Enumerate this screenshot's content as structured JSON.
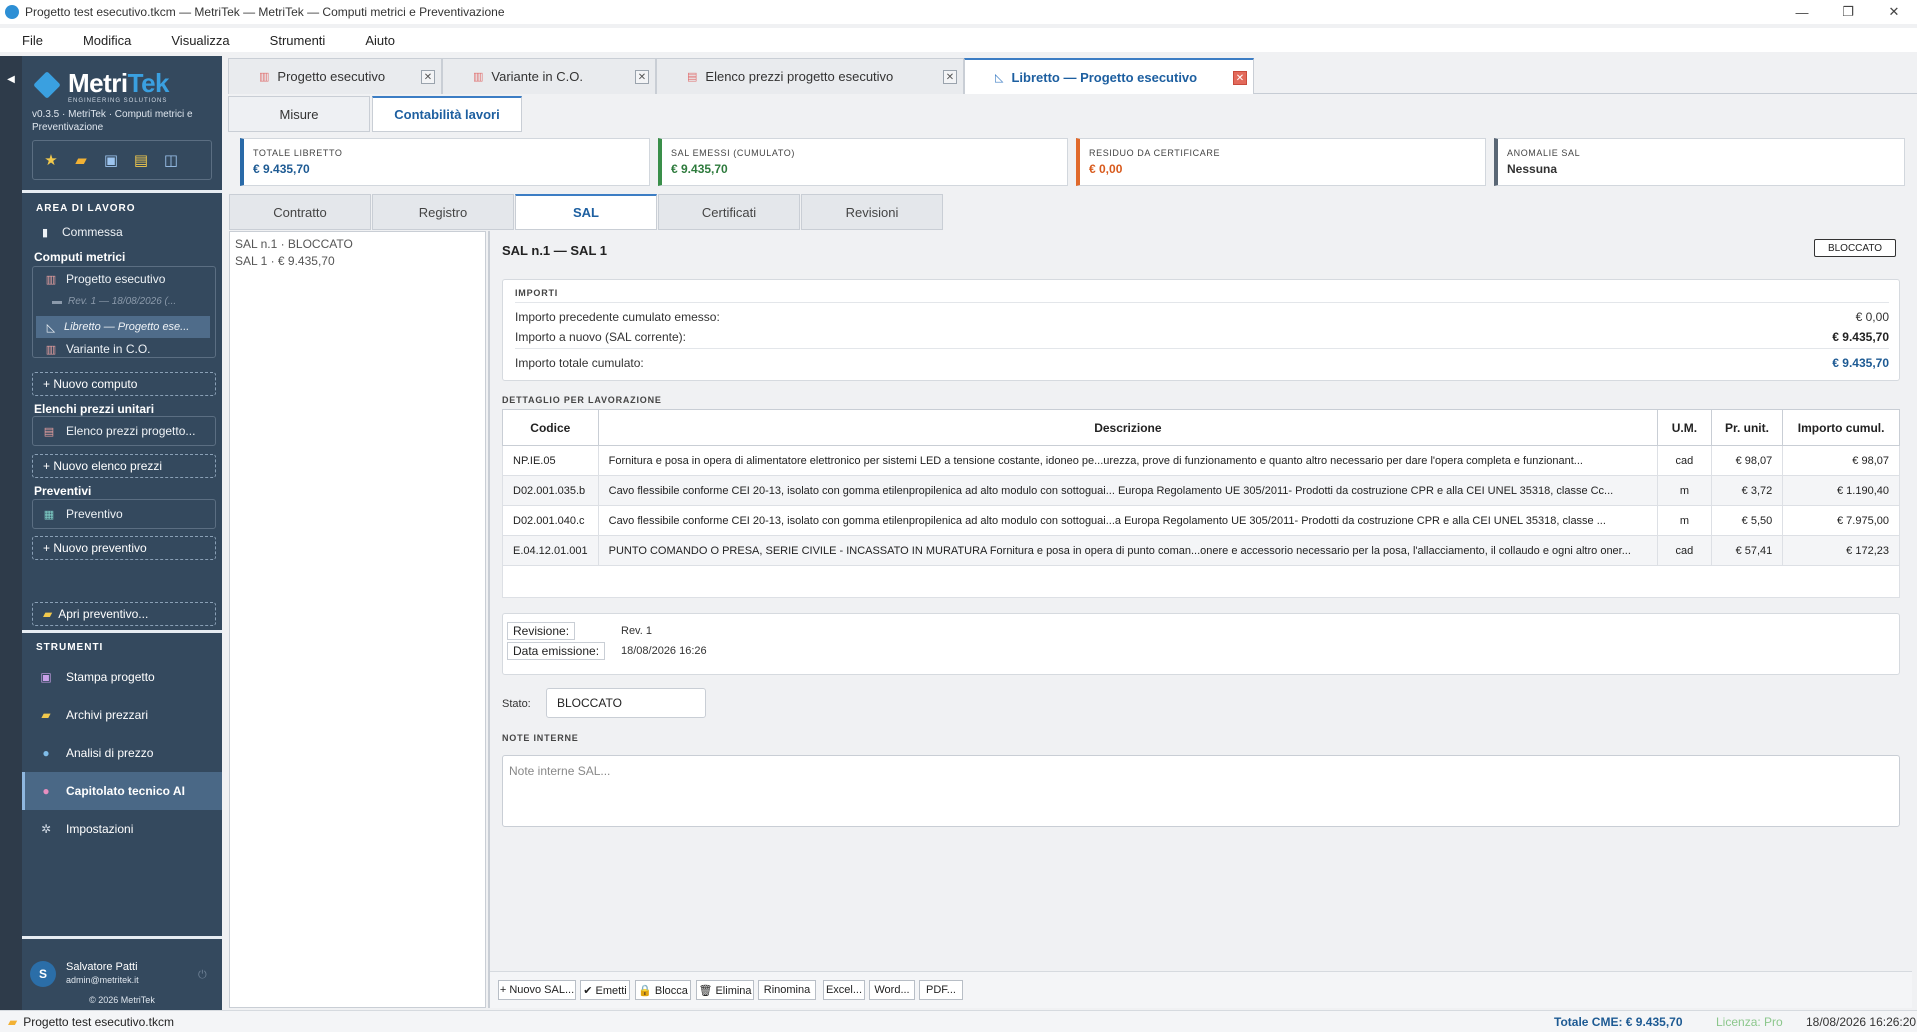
{
  "window": {
    "title": "Progetto test esecutivo.tkcm — MetriTek — MetriTek — Computi metrici e Preventivazione"
  },
  "menu": [
    "File",
    "Modifica",
    "Visualizza",
    "Strumenti",
    "Aiuto"
  ],
  "sidebar": {
    "logo_main": "Metri",
    "logo_accent": "Tek",
    "logo_sub": "ENGINEERING SOLUTIONS",
    "version": "v0.3.5  ·  MetriTek  ·  Computi metrici e Preventivazione",
    "area_title": "AREA DI LAVORO",
    "commessa": "Commessa",
    "computi_title": "Computi metrici",
    "computi": [
      "Progetto esecutivo",
      "Rev. 1 — 18/08/2026  (...",
      "Libretto — Progetto ese...",
      "Variante in C.O."
    ],
    "nuovo_computo": "+  Nuovo computo",
    "elenchi_title": "Elenchi prezzi unitari",
    "elenco_item": "Elenco prezzi progetto...",
    "nuovo_elenco": "+  Nuovo elenco prezzi",
    "preventivi_title": "Preventivi",
    "preventivo_item": "Preventivo",
    "nuovo_preventivo": "+  Nuovo preventivo",
    "apri_preventivo": "Apri preventivo...",
    "strumenti_title": "STRUMENTI",
    "strumenti": [
      "Stampa progetto",
      "Archivi prezzari",
      "Analisi di prezzo",
      "Capitolato tecnico AI",
      "Impostazioni"
    ],
    "user": {
      "initial": "S",
      "name": "Salvatore Patti",
      "email": "admin@metritek.it",
      "copyright": "© 2026 MetriTek"
    }
  },
  "doc_tabs": [
    "Progetto esecutivo",
    "Variante in C.O.",
    "Elenco prezzi progetto esecutivo",
    "Libretto — Progetto esecutivo"
  ],
  "view_tabs": [
    "Misure",
    "Contabilità lavori"
  ],
  "cards": [
    {
      "label": "TOTALE LIBRETTO",
      "value": "€ 9.435,70",
      "color": "#2a6aa8"
    },
    {
      "label": "SAL EMESSI (CUMULATO)",
      "value": "€ 9.435,70",
      "color": "#3a8f4a"
    },
    {
      "label": "RESIDUO DA CERTIFICARE",
      "value": "€ 0,00",
      "color": "#e0692b"
    },
    {
      "label": "ANOMALIE SAL",
      "value": "Nessuna",
      "color": "#5a6775"
    }
  ],
  "section_tabs": [
    "Contratto",
    "Registro",
    "SAL",
    "Certificati",
    "Revisioni"
  ],
  "sal_list": [
    "SAL n.1  ·  BLOCCATO",
    "SAL 1  ·  € 9.435,70"
  ],
  "sal": {
    "title": "SAL n.1  —  SAL 1",
    "badge": "BLOCCATO",
    "importi_title": "IMPORTI",
    "importi": [
      {
        "label": "Importo precedente cumulato emesso:",
        "value": "€ 0,00"
      },
      {
        "label": "Importo a nuovo (SAL corrente):",
        "value": "€ 9.435,70"
      },
      {
        "label": "Importo totale cumulato:",
        "value": "€ 9.435,70"
      }
    ],
    "dettaglio_title": "DETTAGLIO PER LAVORAZIONE",
    "columns": [
      "Codice",
      "Descrizione",
      "U.M.",
      "Pr. unit.",
      "Importo cumul."
    ],
    "rows": [
      [
        "NP.IE.05",
        "Fornitura e posa in opera di alimentatore elettronico per sistemi LED a tensione costante, idoneo pe...urezza, prove di funzionamento e quanto altro necessario per dare l'opera completa e funzionant...",
        "cad",
        "€ 98,07",
        "€ 98,07"
      ],
      [
        "D02.001.035.b",
        "Cavo flessibile conforme CEI 20-13, isolato con gomma etilenpropilenica ad alto modulo con sottoguai... Europa Regolamento UE 305/2011- Prodotti da costruzione CPR e alla CEI UNEL 35318, classe Cc...",
        "m",
        "€ 3,72",
        "€ 1.190,40"
      ],
      [
        "D02.001.040.c",
        "Cavo flessibile conforme CEI 20-13, isolato con gomma etilenpropilenica ad alto modulo con sottoguai...a Europa Regolamento UE 305/2011- Prodotti da costruzione CPR e alla CEI UNEL 35318, classe ...",
        "m",
        "€ 5,50",
        "€ 7.975,00"
      ],
      [
        "E.04.12.01.001",
        "PUNTO COMANDO O PRESA, SERIE CIVILE - INCASSATO IN MURATURA Fornitura e posa in opera di punto coman...onere e accessorio necessario per la posa, l'allacciamento, il collaudo e ogni altro oner...",
        "cad",
        "€ 57,41",
        "€ 172,23"
      ]
    ],
    "revisione_label": "Revisione:",
    "revisione_value": "Rev. 1",
    "data_label": "Data emissione:",
    "data_value": "18/08/2026 16:26",
    "stato_label": "Stato:",
    "stato_value": "BLOCCATO",
    "note_title": "NOTE INTERNE",
    "note_placeholder": "Note interne SAL..."
  },
  "buttons": [
    "+  Nuovo SAL...",
    "✔ Emetti",
    "🔒 Blocca",
    "🗑 Elimina",
    "Rinomina",
    "Excel...",
    "Word...",
    "PDF..."
  ],
  "statusbar": {
    "file": "Progetto test esecutivo.tkcm",
    "total": "Totale CME: € 9.435,70",
    "license": "Licenza: Pro",
    "datetime": "18/08/2026   16:26:20"
  }
}
